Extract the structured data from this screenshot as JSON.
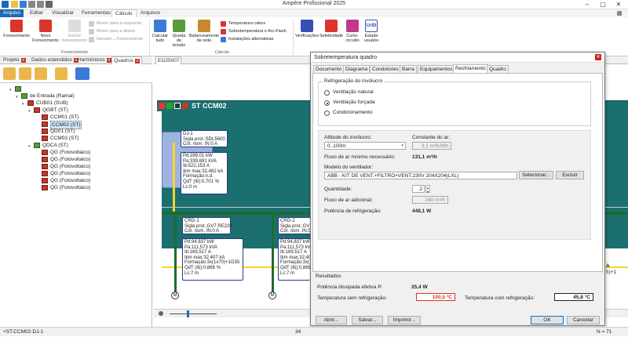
{
  "app": {
    "title": "Ampère Profissional 2025"
  },
  "menu": {
    "arquivo": "Arquivo",
    "editar": "Editar",
    "visualizar": "Visualizar",
    "ferramentas": "Ferramentas",
    "calculo": "Cálculo",
    "arquivos": "Arquivos"
  },
  "ribbon": {
    "fornecimento": "Fornecimento",
    "novo_fornecimento": "Novo Fornecimento",
    "excluir_fornecimento": "Excluir fornecimento",
    "mover_esquerda": "Mover para a esquerda",
    "mover_direita": "Mover para a direita",
    "gerador_fornecimento": "Gerador→Fornecimento",
    "grupo_fornecimento": "Fornecimento",
    "calcular_tudo": "Calcular tudo",
    "queda_tensao": "Queda de tensão",
    "balanceamento": "Balanceamento de rede",
    "temperatura_cabos": "Temperatura cabos",
    "sobretemperatura_arc": "Sobretemperatura e Arc-Flash",
    "instalacoes_alternativas": "Instalações alternativas",
    "grupo_calculo": "Cálculo",
    "verificacoes": "Verificações",
    "seletividade": "Seletividade",
    "curto_circuito": "Curto-circuito",
    "estado_usuario": "Estado usuário",
    "user_badge": "UrBI"
  },
  "left_tabs": [
    {
      "label": "Projeto"
    },
    {
      "label": "Dados estendidos"
    },
    {
      "label": "Harmônicos"
    },
    {
      "label": "Quadros"
    }
  ],
  "tree": [
    {
      "label": "de Entrada (Ramal)"
    },
    {
      "label": "CUB01 (SUB)"
    },
    {
      "label": "QGBT (ST)"
    },
    {
      "label": "CCM01 (ST)"
    },
    {
      "label": "CCM02 (ST)"
    },
    {
      "label": "QD01 (ST)"
    },
    {
      "label": "CCM03 (ST)"
    },
    {
      "label": "QDCA (ST)"
    },
    {
      "label": "QG (Fotovoltaico)"
    },
    {
      "label": "QG (Fotovoltaico)"
    },
    {
      "label": "QG (Fotovoltaico)"
    },
    {
      "label": "QG (Fotovoltaico)"
    },
    {
      "label": "QG (Fotovoltaico)"
    },
    {
      "label": "QG (Fotovoltaico)"
    }
  ],
  "drawing": {
    "tab": "EG25007",
    "header_title": "ST CCM02",
    "dj1": {
      "l1": "DJ-1",
      "l2": "Sigla prot.:SDL5600",
      "l3": "Cor. nom. IN:0 A",
      "m1": "Pd:289,01 kW",
      "m2": "Pa:339,691 kVA",
      "m3": "Ib:522,153 A",
      "m4": "Ikm max:32,482 kA",
      "m5": "Formação:n.d.",
      "m6": "QdT (Ib):0,701 %",
      "m7": "Lc:0 m"
    },
    "crg1": {
      "l1": "CRG-1",
      "l2": "Sigla prot.:GV7 RE220",
      "l3": "Cor. nom. IN:0 A",
      "m1": "Pd:94,837 kW",
      "m2": "Pa:111,573 kVA",
      "m3": "Ib:169,517 A",
      "m4": "Ikm max:32,407 kA",
      "m5": "Formação:3x(1x70)+1G35",
      "m6": "QdT (Ib):0,866 %",
      "m7": "Lc:7 m"
    },
    "crg2": {
      "l1": "CRG-2",
      "l2": "Sigla prot.:GV7",
      "l3": "Cor. nom. IN:0 A",
      "m1": "Pd:94,837 kW",
      "m2": "Pa:111,573 kVA",
      "m3": "Ib:169,517 A",
      "m4": "Ikm max:32,40",
      "m5": "Formação:3x(1",
      "m6": "QdT (Ib):0,866",
      "m7": "Lc:7 m"
    },
    "right_clip_1": "A",
    "right_clip_2": "5)+1"
  },
  "dialog": {
    "title": "Sobretemperatura quadro",
    "tabs": [
      {
        "label": "Documento"
      },
      {
        "label": "Diagrama"
      },
      {
        "label": "Condutores"
      },
      {
        "label": "Barra"
      },
      {
        "label": "Equipamentos"
      },
      {
        "label": "Resfriamento"
      },
      {
        "label": "Quadro"
      }
    ],
    "refrig_group": "Refrigeração do invólucro",
    "r_natural": "Ventilação natural",
    "r_forcada": "Ventilação forçada",
    "r_cond": "Condicionamento",
    "altitude_label": "Altitude do invólucro:",
    "altitude_value": "0..100m",
    "constante_label": "Constante do ar:",
    "constante_value": "3,1 m³K/Wh",
    "fluxo_min_label": "Fluxo de ar mínimo necessário:",
    "fluxo_min_value": "131,1 m³/h",
    "modelo_label": "Modelo do ventilador:",
    "modelo_value": "ABB - KIT DE VENT.+FILTRO+VENT.230V 204X204(LXL)",
    "selecionar": "Selecionar...",
    "excluir": "Excluir",
    "quantidade_label": "Quantidade:",
    "quantidade_value": "2",
    "fluxo_ad_label": "Fluxo de ar adicional:",
    "fluxo_ad_value": "240 m³/h",
    "potencia_label": "Potência de refrigeração:",
    "potencia_value": "448,1 W",
    "resultados": "Resultados",
    "pot_dissipada_label": "Potência dissipada efetiva P:",
    "pot_dissipada_value": "25,4 W",
    "temp_sem_label": "Temperatura sem refrigeração:",
    "temp_sem_value": "100,5 °C",
    "temp_com_label": "Temperatura com refrigeração:",
    "temp_com_value": "45,8 °C",
    "abrir": "Abrir...",
    "salvar": "Salvar...",
    "imprimir": "Imprimir...",
    "ok": "OK",
    "cancelar": "Cancelar"
  },
  "status": {
    "left": "+ST.CCM02-DJ-1",
    "mid": "34",
    "right": "N = 71"
  },
  "colors": {
    "accent": "#1c6ab5",
    "drawing_teal": "#1b6f6f",
    "busbar_green": "#1e6b30",
    "card_blue": "#2a3a8a",
    "hot_red": "#d9352c"
  }
}
